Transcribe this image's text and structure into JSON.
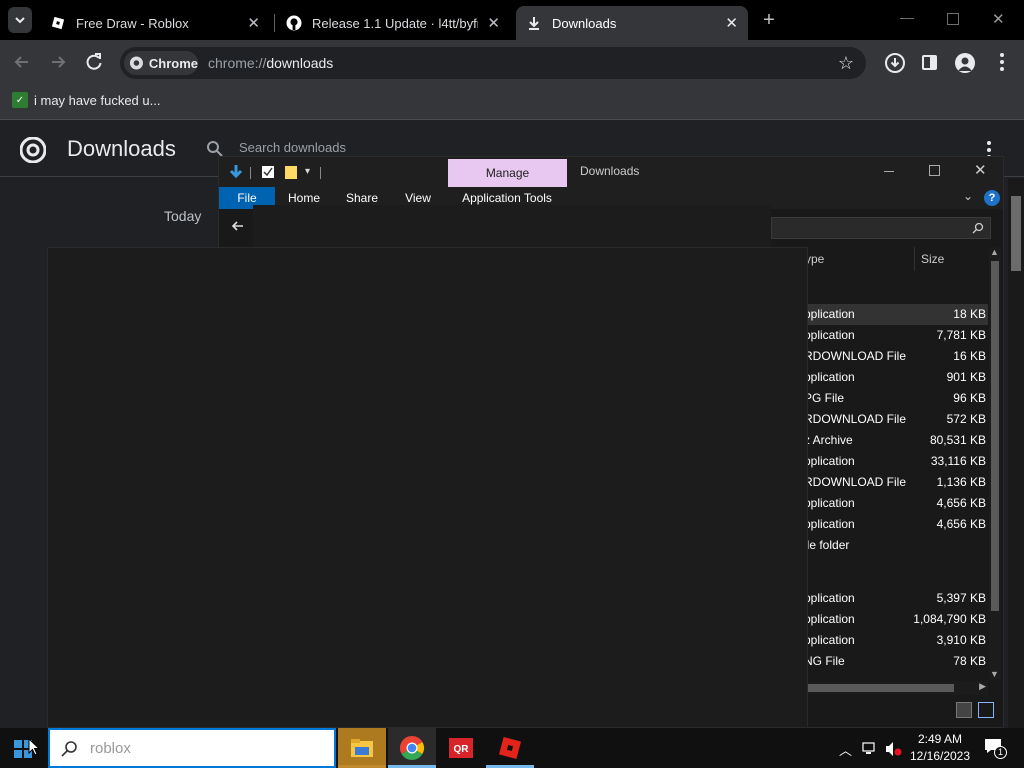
{
  "browser": {
    "tabs": [
      {
        "title": "Free Draw - Roblox",
        "icon": "roblox-icon"
      },
      {
        "title": "Release 1.1 Update · l4tt/byfron",
        "icon": "github-icon"
      },
      {
        "title": "Downloads",
        "icon": "download-icon",
        "active": true
      }
    ],
    "omnibox": {
      "chip": "Chrome",
      "url_prefix": "chrome://",
      "url_path": "downloads"
    },
    "bookmark": {
      "label": "i may have fucked u..."
    }
  },
  "downloads_page": {
    "title": "Downloads",
    "search_placeholder": "Search downloads",
    "group_label": "Today"
  },
  "explorer": {
    "title": "Downloads",
    "contextual_tab": "Manage",
    "ribbon_tabs": [
      "File",
      "Home",
      "Share",
      "View",
      "Application Tools"
    ],
    "columns": {
      "type": "ype",
      "size": "Size"
    },
    "rows": [
      {
        "type": "pplication",
        "size": "18 KB",
        "selected": true
      },
      {
        "type": "pplication",
        "size": "7,781 KB"
      },
      {
        "type": "RDOWNLOAD File",
        "size": "16 KB"
      },
      {
        "type": "pplication",
        "size": "901 KB"
      },
      {
        "type": "PG File",
        "size": "96 KB"
      },
      {
        "type": "RDOWNLOAD File",
        "size": "572 KB"
      },
      {
        "type": "z Archive",
        "size": "80,531 KB"
      },
      {
        "type": "pplication",
        "size": "33,116 KB"
      },
      {
        "type": "RDOWNLOAD File",
        "size": "1,136 KB"
      },
      {
        "type": "pplication",
        "size": "4,656 KB"
      },
      {
        "type": "pplication",
        "size": "4,656 KB"
      },
      {
        "type": "ile folder",
        "size": ""
      },
      {
        "type": "",
        "size": ""
      },
      {
        "type": "pplication",
        "size": "5,397 KB"
      },
      {
        "type": "pplication",
        "size": "1,084,790 KB"
      },
      {
        "type": "pplication",
        "size": "3,910 KB"
      },
      {
        "type": "NG File",
        "size": "78 KB"
      }
    ]
  },
  "taskbar": {
    "search_text": "roblox",
    "time": "2:49 AM",
    "date": "12/16/2023",
    "notification_count": "1"
  },
  "colors": {
    "chrome_dark": "#35363a",
    "explorer_accent": "#0063b1",
    "manage_tab": "#e8c7f0",
    "bookmark_green": "#2e7d32"
  }
}
